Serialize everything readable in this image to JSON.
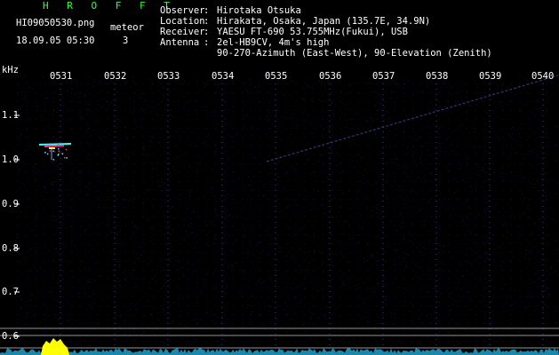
{
  "header": {
    "brand": "H R O F F T",
    "filename": "HI09050530.png",
    "meteor_label": "meteor",
    "timestamp": "18.09.05 05:30",
    "meteor_count": "3"
  },
  "metadata": [
    {
      "key": "Observer",
      "value": "Hirotaka Otsuka"
    },
    {
      "key": "Location",
      "value": "Hirakata, Osaka, Japan (135.7E, 34.9N)"
    },
    {
      "key": "Receiver",
      "value": "YAESU FT-690 53.755MHz(Fukui), USB"
    },
    {
      "key": "Antenna",
      "value": "2el-HB9CV, 4m's high"
    },
    {
      "key": "",
      "value": "90-270-Azimuth (East-West), 90-Elevation (Zenith)"
    }
  ],
  "axis": {
    "unit": "kHz",
    "time_labels": [
      "0531",
      "0532",
      "0533",
      "0534",
      "0535",
      "0536",
      "0537",
      "0538",
      "0539",
      "0540"
    ],
    "freq_labels": [
      "1.1",
      "1.0",
      "0.9",
      "0.8",
      "0.7",
      "0.6"
    ]
  },
  "colors": {
    "brand": "#33ff33",
    "text": "#ffffff",
    "background": "#000000",
    "noise": "#1a1a66",
    "grid": "#5050a0",
    "echo_cyan": "#33ffff",
    "echo_magenta": "#ff3399",
    "echo_yellow": "#ffff00",
    "reference_line": "#c8c8c8"
  }
}
